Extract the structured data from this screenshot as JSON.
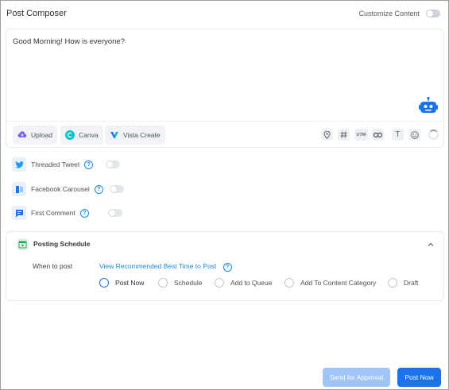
{
  "header": {
    "title": "Post Composer",
    "customize_label": "Customize Content",
    "customize_enabled": false
  },
  "editor": {
    "text": "Good Morning! How is everyone?",
    "assistant_icon": "robot-icon"
  },
  "toolbar": {
    "upload_label": "Upload",
    "canva_label": "Canva",
    "vista_label": "Vista Create",
    "tools": [
      "location-icon",
      "hashtag-icon",
      "utm-icon",
      "link-icon",
      "text-format-icon",
      "emoji-icon"
    ],
    "utm_text": "UTM",
    "text_glyph": "T"
  },
  "options": [
    {
      "label": "Threaded Tweet",
      "icon": "twitter-icon",
      "enabled": false
    },
    {
      "label": "Facebook Carousel",
      "icon": "carousel-icon",
      "enabled": false
    },
    {
      "label": "First Comment",
      "icon": "comment-icon",
      "enabled": false
    }
  ],
  "schedule": {
    "title": "Posting Schedule",
    "when_label": "When to post",
    "recommend_link": "View Recommended Best Time to Post",
    "choices": [
      "Post Now",
      "Schedule",
      "Add to Queue",
      "Add To Content Category",
      "Draft"
    ],
    "selected": "Post Now"
  },
  "footer": {
    "approval_label": "Send for Approval",
    "post_label": "Post Now"
  },
  "colors": {
    "accent": "#1a73e8",
    "link": "#1a8cd8",
    "approval_disabled": "#9fc4f5"
  }
}
